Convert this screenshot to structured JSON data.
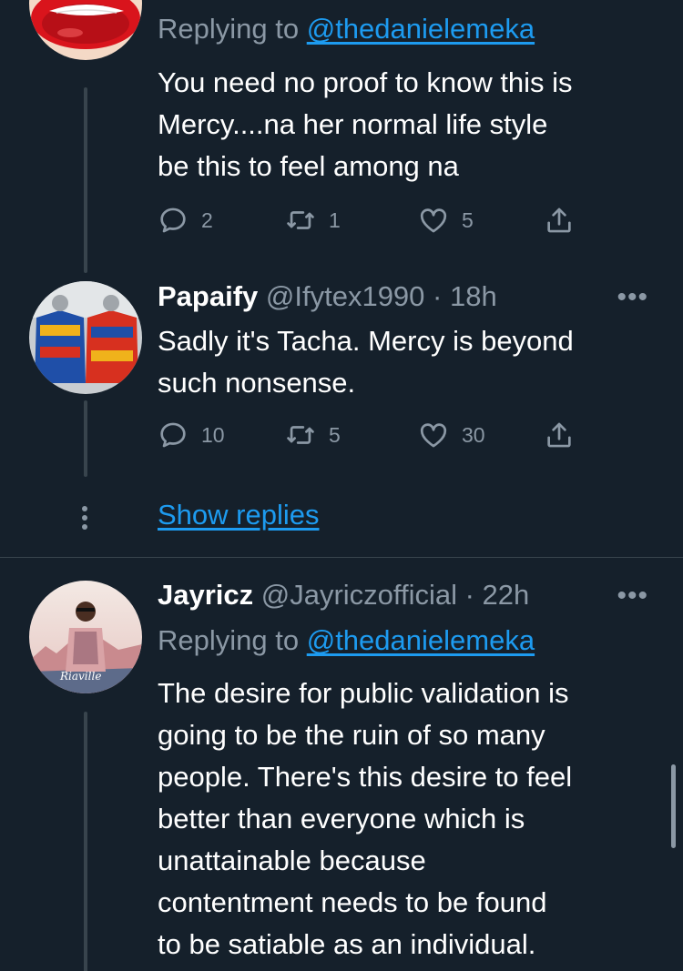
{
  "tweets": [
    {
      "reply_prefix": "Replying to ",
      "reply_handle": "@thedanielemeka",
      "text_lines": [
        "You need no proof to know this is",
        "Mercy....na her normal life style",
        "be this to feel among na"
      ],
      "actions": {
        "replies": "2",
        "retweets": "1",
        "likes": "5"
      }
    },
    {
      "name": "Papaify",
      "handle": "@Ifytex1990",
      "time": "· 18h",
      "more": "•••",
      "text_lines": [
        "Sadly it's Tacha. Mercy is beyond",
        "such nonsense."
      ],
      "actions": {
        "replies": "10",
        "retweets": "5",
        "likes": "30"
      }
    },
    {
      "name": "Jayricz",
      "handle": "@Jayriczofficial",
      "time": "· 22h",
      "more": "•••",
      "reply_prefix": "Replying to ",
      "reply_handle": "@thedanielemeka",
      "avatar_text": "Riaville",
      "text_lines": [
        "The desire for public validation is",
        "going to be the ruin of so many",
        "people. There's this desire to feel",
        "better than everyone which is",
        "unattainable because",
        "contentment needs to be found",
        "to be satiable as an individual."
      ]
    }
  ],
  "show_replies": "Show replies",
  "colors": {
    "background": "#15202b",
    "secondary": "#8b98a5",
    "link": "#1d9bf0",
    "border": "#38444d"
  }
}
